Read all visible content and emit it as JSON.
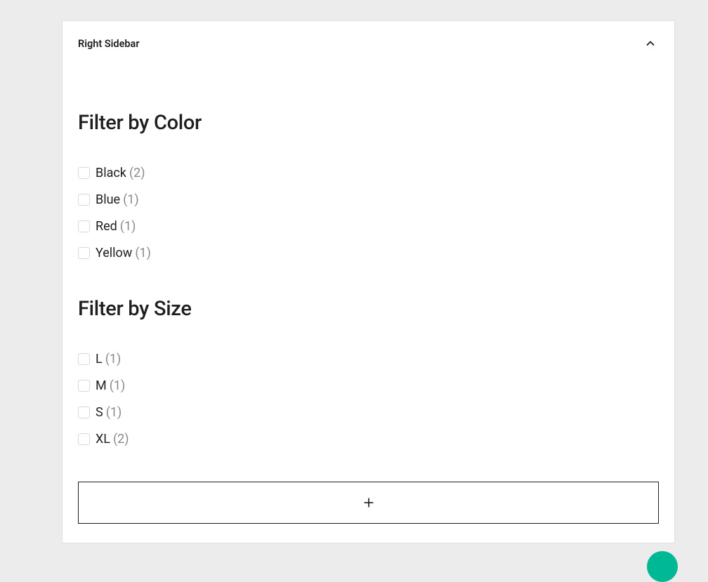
{
  "panel": {
    "title": "Right Sidebar"
  },
  "filters": [
    {
      "heading": "Filter by Color",
      "items": [
        {
          "label": "Black",
          "count": "(2)"
        },
        {
          "label": "Blue",
          "count": "(1)"
        },
        {
          "label": "Red",
          "count": "(1)"
        },
        {
          "label": "Yellow",
          "count": "(1)"
        }
      ]
    },
    {
      "heading": "Filter by Size",
      "items": [
        {
          "label": "L",
          "count": "(1)"
        },
        {
          "label": "M",
          "count": "(1)"
        },
        {
          "label": "S",
          "count": "(1)"
        },
        {
          "label": "XL",
          "count": "(2)"
        }
      ]
    }
  ]
}
